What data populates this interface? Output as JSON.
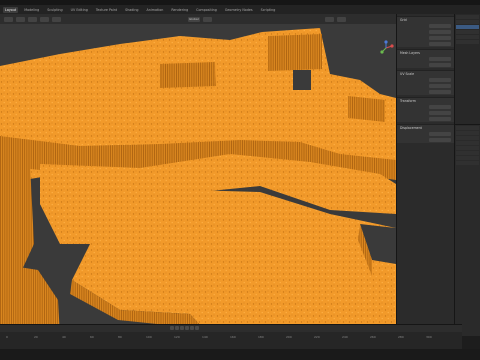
{
  "app": {
    "window_title": ""
  },
  "menubar": {
    "tabs": [
      "Layout",
      "Modeling",
      "Sculpting",
      "UV Editing",
      "Texture Paint",
      "Shading",
      "Animation",
      "Rendering",
      "Compositing",
      "Geometry Nodes",
      "Scripting"
    ],
    "active_tab": "Layout"
  },
  "viewport": {
    "mode_label": "Global",
    "terrain_color": "#f29a2a",
    "background_color": "#3a3a3a"
  },
  "npanel": {
    "sections": [
      {
        "title": "Grid",
        "fields": [
          "",
          "",
          "",
          ""
        ]
      },
      {
        "title": "Mesh Layers",
        "fields": [
          "",
          ""
        ]
      },
      {
        "title": "UV Scale",
        "fields": [
          "",
          "",
          ""
        ]
      },
      {
        "title": "Transform",
        "fields": [
          "",
          "",
          ""
        ]
      },
      {
        "title": "Displacement",
        "fields": [
          "",
          ""
        ]
      }
    ]
  },
  "outliner": {
    "rows": [
      "",
      "",
      "",
      "",
      "",
      ""
    ]
  },
  "properties": {
    "rows": [
      "",
      "",
      "",
      "",
      "",
      "",
      "",
      ""
    ]
  },
  "timeline": {
    "ruler_ticks": [
      "0",
      "20",
      "40",
      "60",
      "80",
      "100",
      "120",
      "140",
      "160",
      "180",
      "200",
      "220",
      "240",
      "260",
      "280",
      "300"
    ]
  },
  "statusbar": {
    "text": ""
  },
  "colors": {
    "accent": "#3b5a82",
    "selection": "#f29a2a"
  },
  "icons": [
    "axis-gizmo-icon",
    "play-icon",
    "search-icon"
  ]
}
